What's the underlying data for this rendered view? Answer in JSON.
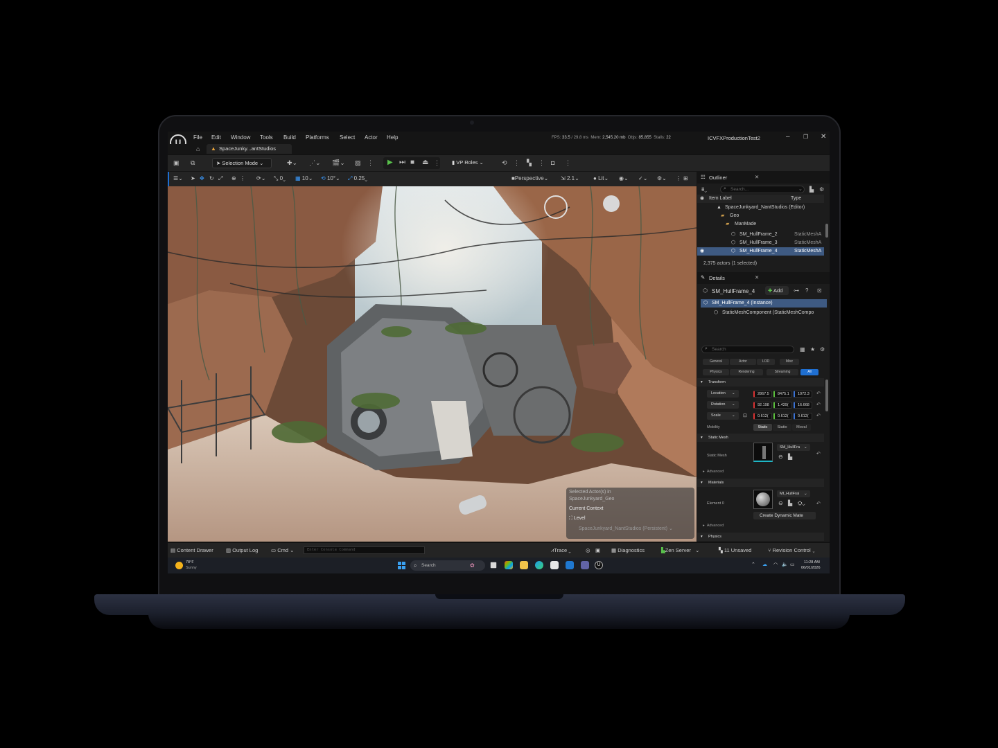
{
  "app": {
    "logo": "U",
    "menus": [
      "File",
      "Edit",
      "Window",
      "Tools",
      "Build",
      "Platforms",
      "Select",
      "Actor",
      "Help"
    ],
    "stats": {
      "fps_label": "FPS:",
      "fps": "33.5",
      "ms": "/ 29.8 ms",
      "mem_label": "Mem:",
      "mem": "2,545.20 mb",
      "objs_label": "Objs:",
      "objs": "85,855",
      "stalls_label": "Stalls:",
      "stalls": "22"
    },
    "project": "ICVFXProductionTest2",
    "window_controls": {
      "minimize": "–",
      "restore": "❐",
      "close": "✕"
    },
    "level_tab": "SpaceJunky...antStudios"
  },
  "toolbar": {
    "mode": "Selection Mode",
    "vp_roles": "VP Roles"
  },
  "viewport_toolbar": {
    "snap_rot": "0",
    "grid": "10",
    "rot": "10°",
    "scale": "0.25",
    "view": "Perspective",
    "camera_speed": "2.1",
    "lit": "Lit"
  },
  "context": {
    "line1": "Selected Actor(s) in",
    "line2": "SpaceJunkyard_Geo",
    "current": "Current Context",
    "level_label": "Level",
    "level_value": "SpaceJunkyard_NantStudios (Persistent)"
  },
  "outliner": {
    "title": "Outliner",
    "search_placeholder": "Search...",
    "col_label": "Item Label",
    "col_type": "Type",
    "rows": [
      {
        "label": "SpaceJunkyard_NantStudios (Editor)",
        "type": ""
      },
      {
        "label": "Geo",
        "type": ""
      },
      {
        "label": "ManMade",
        "type": ""
      },
      {
        "label": "SM_HullFrame_2",
        "type": "StaticMeshA"
      },
      {
        "label": "SM_HullFrame_3",
        "type": "StaticMeshA"
      },
      {
        "label": "SM_HullFrame_4",
        "type": "StaticMeshA"
      }
    ],
    "count": "2,375 actors (1 selected)"
  },
  "details": {
    "title": "Details",
    "object": "SM_HullFrame_4",
    "add": "Add",
    "instance": "SM_HullFrame_4 (Instance)",
    "component": "StaticMeshComponent (StaticMeshCompo",
    "search_placeholder": "Search",
    "cats_row1": [
      "General",
      "Actor",
      "LOD",
      "Misc"
    ],
    "cats_row2": [
      "Physics",
      "Rendering",
      "Streaming",
      "All"
    ],
    "transform": "Transform",
    "location": {
      "label": "Location",
      "x": "2867.5",
      "y": "8475.1",
      "z": "1072.3"
    },
    "rotation": {
      "label": "Rotation",
      "x": "92.198",
      "y": "1.439(",
      "z": "16.668"
    },
    "scale": {
      "label": "Scale",
      "x": "0.612(",
      "y": "0.612(",
      "z": "0.612("
    },
    "mobility": {
      "label": "Mobility",
      "opts": [
        "Static",
        "Statio",
        "Moval"
      ]
    },
    "static_mesh_section": "Static Mesh",
    "static_mesh_label": "Static Mesh",
    "static_mesh_value": "SM_HullFra",
    "advanced": "Advanced",
    "materials": "Materials",
    "element0": "Element 0",
    "material_value": "MI_HullFrai",
    "create_dynamic": "Create Dynamic Mate",
    "advanced2": "Advanced",
    "physics": "Physics"
  },
  "statusbar": {
    "content_drawer": "Content Drawer",
    "output_log": "Output Log",
    "cmd": "Cmd",
    "console_placeholder": "Enter Console Command",
    "trace": "Trace",
    "diagnostics": "Diagnostics",
    "zen": "Zen Server",
    "unsaved": "11 Unsaved",
    "revision": "Revision Control"
  },
  "taskbar": {
    "temp": "78°F",
    "weather": "Sunny",
    "search": "Search",
    "time": "11:28 AM",
    "date": "06/01/2026"
  },
  "colors": {
    "accent": "#1f6fd1",
    "selection": "#3e5a82",
    "play": "#59c14b"
  }
}
